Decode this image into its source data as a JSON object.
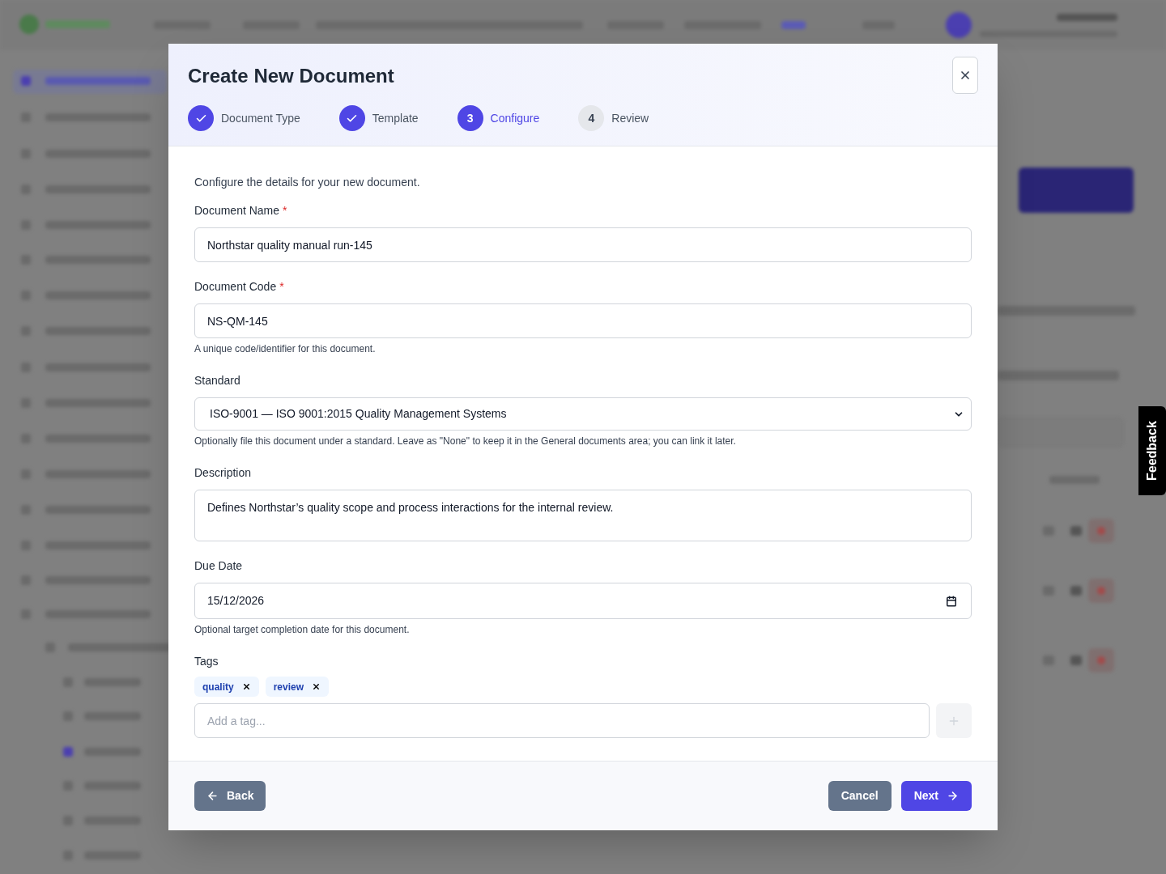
{
  "dialog": {
    "title": "Create New Document",
    "steps": [
      {
        "label": "Document Type",
        "completed": true,
        "selected": false
      },
      {
        "label": "Template",
        "completed": true,
        "selected": false
      },
      {
        "number": "3",
        "label": "Configure",
        "completed": false,
        "selected": true
      },
      {
        "number": "4",
        "label": "Review",
        "completed": false,
        "selected": false
      }
    ],
    "intro": "Configure the details for your new document.",
    "fields": [
      {
        "kind": "text",
        "label": "Document Name",
        "required_mark": "*",
        "value": "Northstar quality manual run-145"
      },
      {
        "kind": "text",
        "label": "Document Code",
        "required_mark": "*",
        "value": "NS-QM-145",
        "help": "A unique code/identifier for this document."
      },
      {
        "kind": "select",
        "label": "Standard",
        "value": "ISO-9001 — ISO 9001:2015 Quality Management Systems",
        "help": "Optionally file this document under a standard. Leave as \"None\" to keep it in the General documents area; you can link it later."
      },
      {
        "kind": "textarea",
        "label": "Description",
        "value": "Defines Northstar’s quality scope and process interactions for the internal review."
      },
      {
        "kind": "date",
        "label": "Due Date",
        "value": "15/12/2026",
        "help": "Optional target completion date for this document."
      },
      {
        "kind": "tags",
        "label": "Tags",
        "tags": [
          "quality",
          "review"
        ],
        "placeholder": "Add a tag..."
      }
    ],
    "buttons": {
      "back": "Back",
      "cancel": "Cancel",
      "next": "Next"
    }
  },
  "feedback_tab": "Feedback"
}
